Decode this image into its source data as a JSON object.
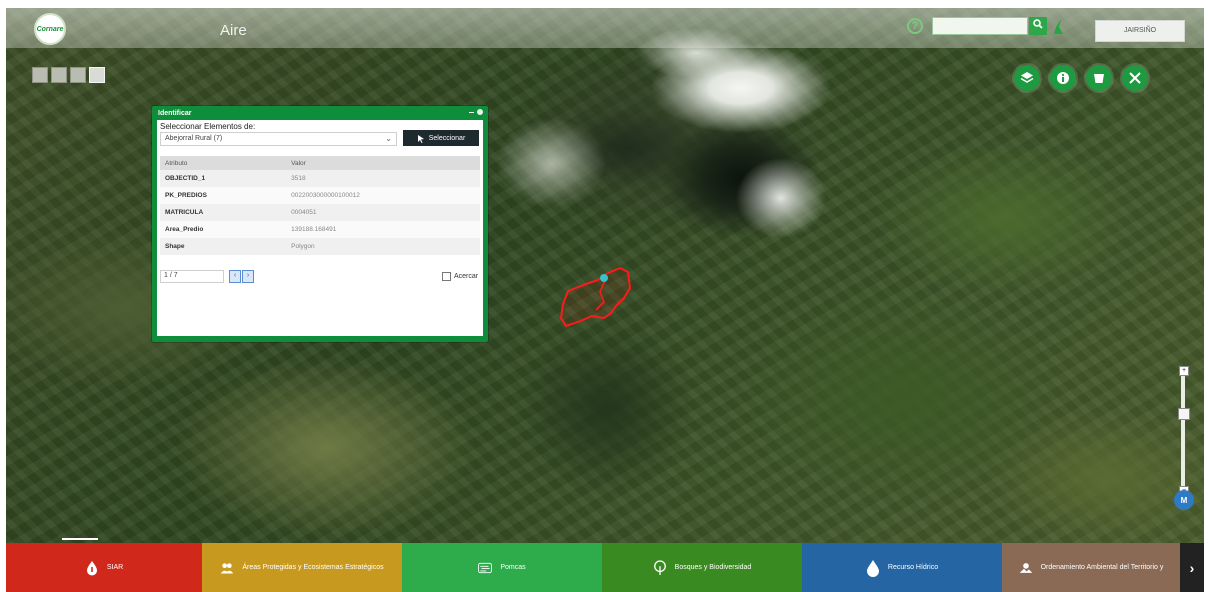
{
  "header": {
    "app_title": "Aire",
    "logo_text": "Cornare",
    "search": {
      "value": "",
      "placeholder": ""
    },
    "user_label": "JAIRSIÑO"
  },
  "identify_dialog": {
    "title": "Identificar",
    "select_label": "Seleccionar Elementos de:",
    "selected_layer": "Abejorral Rural (7)",
    "select_button": "Seleccionar",
    "columns": [
      "Atributo",
      "Valor"
    ],
    "rows": [
      {
        "attr": "OBJECTID_1",
        "value": "3518"
      },
      {
        "attr": "PK_PREDIOS",
        "value": "0022003000000100012"
      },
      {
        "attr": "MATRICULA",
        "value": "0004051"
      },
      {
        "attr": "Area_Predio",
        "value": "139188.168491"
      },
      {
        "attr": "Shape",
        "value": "Polygon"
      }
    ],
    "pager": "1 / 7",
    "zoom_label": "Acercar"
  },
  "bottom_nav": [
    {
      "label": "SIAR",
      "color": "#d1281c",
      "icon": "info-drop-icon"
    },
    {
      "label": "Áreas Protegidas y Ecosistemas Estratégicos",
      "color": "#c79a1f",
      "icon": "people-leaf-icon"
    },
    {
      "label": "Pomcas",
      "color": "#2eab4a",
      "icon": "river-basin-icon"
    },
    {
      "label": "Bosques y Biodiversidad",
      "color": "#3a8a22",
      "icon": "tree-icon"
    },
    {
      "label": "Recurso Hídrico",
      "color": "#2565a4",
      "icon": "water-drop-icon"
    },
    {
      "label": "Ordenamiento Ambiental del Territorio y",
      "color": "#8a6a55",
      "icon": "landscape-icon"
    }
  ],
  "tools": [
    {
      "icon": "layers-icon"
    },
    {
      "icon": "info-icon"
    },
    {
      "icon": "bucket-icon"
    },
    {
      "icon": "tools-icon"
    }
  ],
  "colors": {
    "accent": "#1e9a41",
    "parcel_outline": "#ff1a1a"
  }
}
